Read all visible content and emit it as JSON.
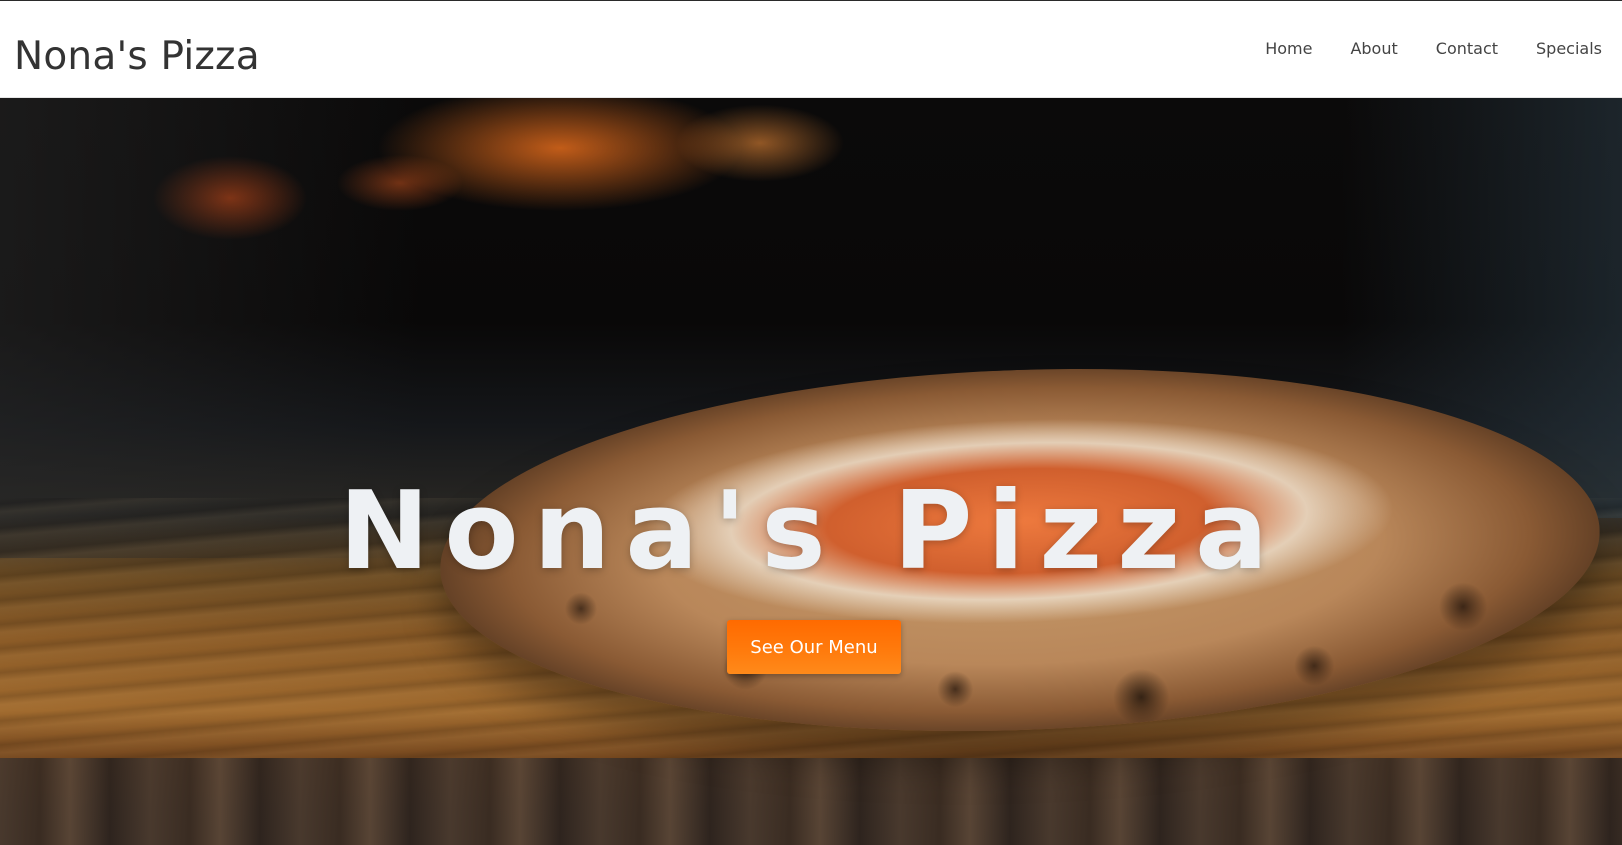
{
  "header": {
    "brand": "Nona's Pizza",
    "nav": [
      "Home",
      "About",
      "Contact",
      "Specials"
    ]
  },
  "hero": {
    "title": "Nona's Pizza",
    "cta_label": "See Our Menu",
    "background_image": "pizza-in-front-of-wood-fired-oven",
    "cta_color": "#ff7a0c"
  }
}
